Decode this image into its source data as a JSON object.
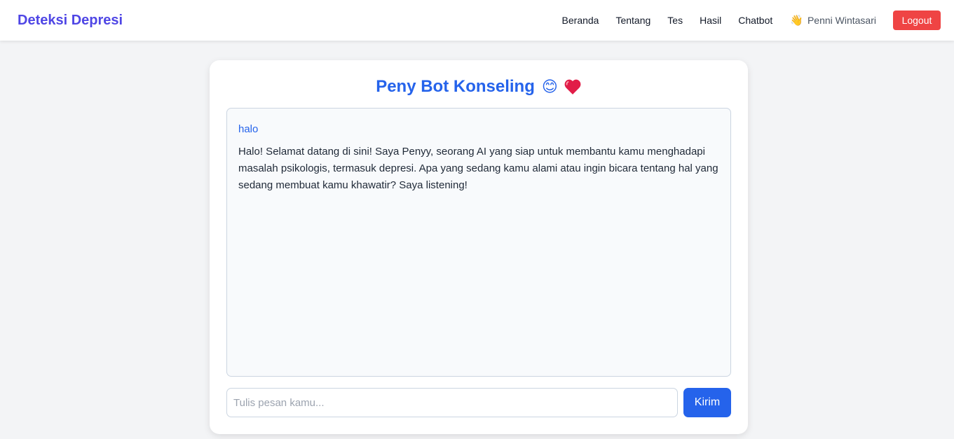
{
  "navbar": {
    "brand": "Deteksi Depresi",
    "links": [
      "Beranda",
      "Tentang",
      "Tes",
      "Hasil",
      "Chatbot"
    ],
    "user_icon": "👋",
    "user_name": "Penni Wintasari",
    "logout_label": "Logout"
  },
  "chat": {
    "title": "Peny Bot Konseling",
    "title_emoji": "😊",
    "title_heart": "heart-icon",
    "messages": [
      {
        "role": "user",
        "text": "halo"
      },
      {
        "role": "bot",
        "text": "Halo! Selamat datang di sini! Saya Penyy, seorang AI yang siap untuk membantu kamu menghadapi masalah psikologis, termasuk depresi. Apa yang sedang kamu alami atau ingin bicara tentang hal yang sedang membuat kamu khawatir? Saya listening!"
      }
    ],
    "input_placeholder": "Tulis pesan kamu...",
    "input_value": "",
    "send_label": "Kirim"
  },
  "colors": {
    "brand": "#4f46e5",
    "accent": "#2563eb",
    "logout": "#ef4444",
    "background": "#f3f4f6"
  }
}
